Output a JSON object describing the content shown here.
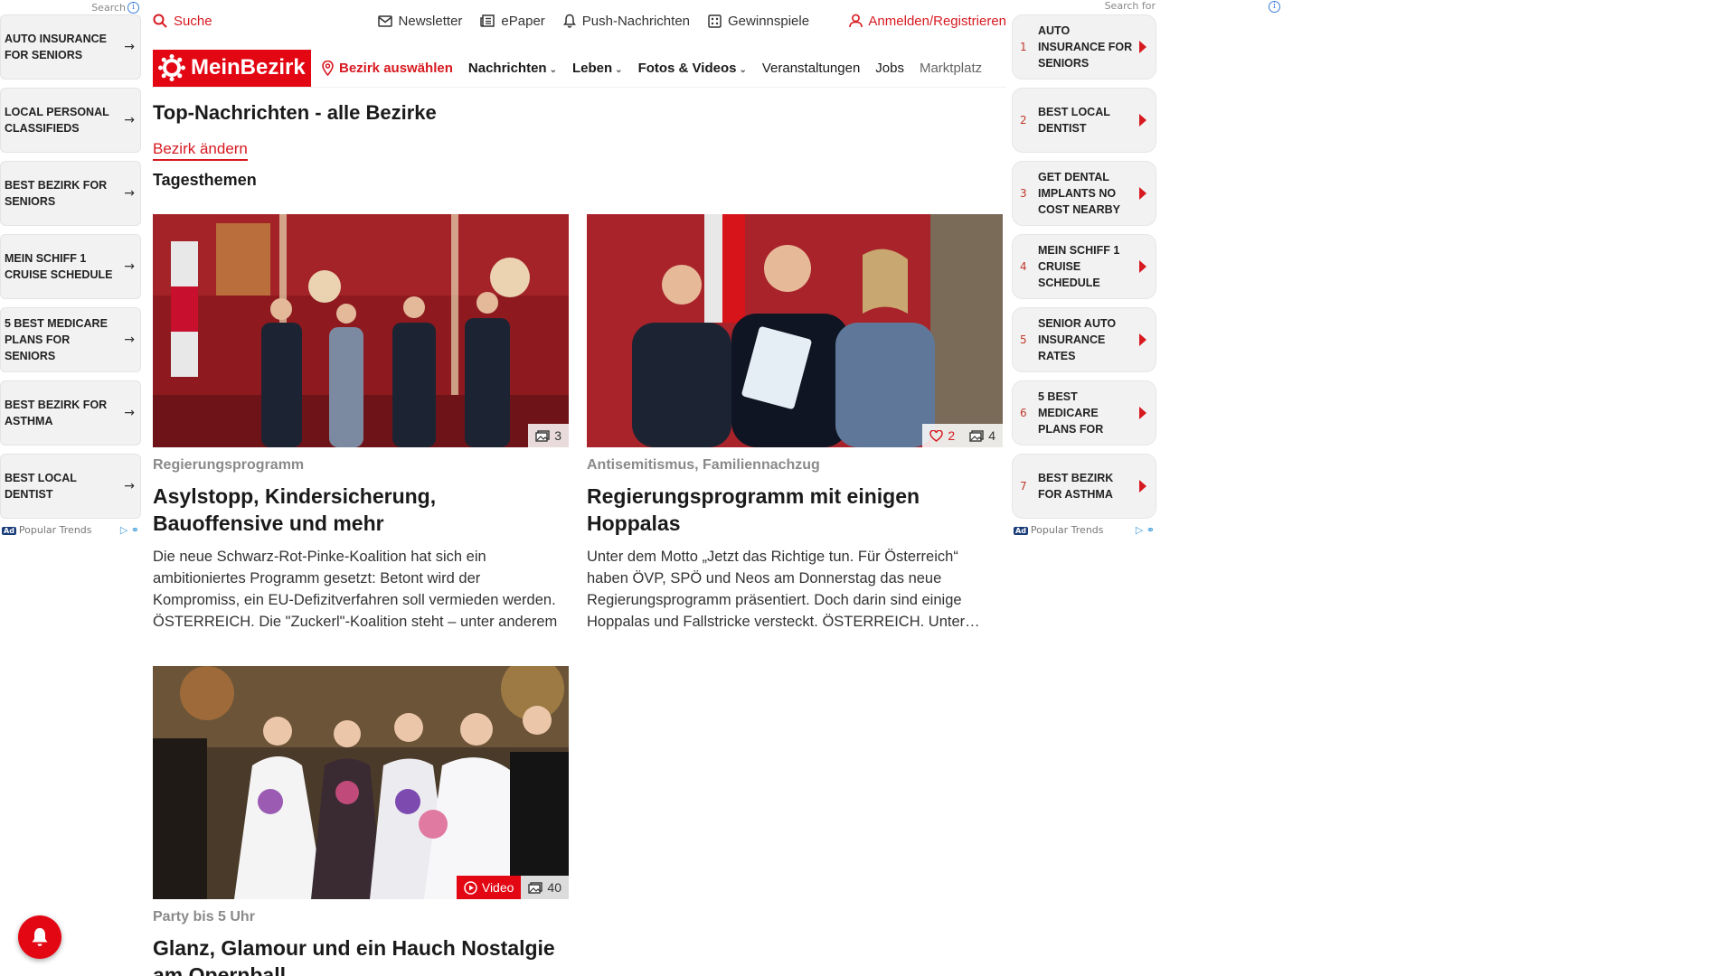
{
  "left_rail": {
    "search_label": "Search",
    "items": [
      {
        "label": "AUTO INSURANCE FOR SENIORS"
      },
      {
        "label": "LOCAL PERSONAL CLASSIFIEDS"
      },
      {
        "label": "BEST BEZIRK FOR SENIORS"
      },
      {
        "label": "MEIN SCHIFF 1 CRUISE SCHEDULE"
      },
      {
        "label": "5 BEST MEDICARE PLANS FOR SENIORS"
      },
      {
        "label": "BEST BEZIRK FOR ASTHMA"
      },
      {
        "label": "BEST LOCAL DENTIST"
      }
    ],
    "footer_badge": "Ad",
    "footer_text": "Popular Trends"
  },
  "utility_bar": {
    "search": "Suche",
    "links": [
      {
        "label": "Newsletter",
        "icon": "mail-icon"
      },
      {
        "label": "ePaper",
        "icon": "newspaper-icon"
      },
      {
        "label": "Push-Nachrichten",
        "icon": "bell-icon"
      },
      {
        "label": "Gewinnspiele",
        "icon": "gift-icon"
      }
    ],
    "login": "Anmelden/Registrieren"
  },
  "main_nav": {
    "logo": "MeinBezirk",
    "bezirk_select": "Bezirk auswählen",
    "items": [
      {
        "label": "Nachrichten",
        "dropdown": true
      },
      {
        "label": "Leben",
        "dropdown": true
      },
      {
        "label": "Fotos & Videos",
        "dropdown": true
      },
      {
        "label": "Veranstaltungen",
        "dropdown": false
      },
      {
        "label": "Jobs",
        "dropdown": false
      },
      {
        "label": "Marktplatz",
        "dropdown": false
      }
    ]
  },
  "content": {
    "page_title": "Top-Nachrichten - alle Bezirke",
    "bezirk_change": "Bezirk ändern",
    "section_title": "Tagesthemen",
    "articles": [
      {
        "kicker": "Regierungsprogramm",
        "headline": "Asylstopp, Kindersicherung, Bauoffensive und mehr",
        "teaser": "Die neue Schwarz-Rot-Pinke-Koalition hat sich ein ambitioniertes Programm gesetzt: Betont wird der Kompromiss, ein EU-Defizitverfahren soll vermieden werden.  ÖSTERREICH. Die \"Zuckerl\"-Koalition steht – unter anderem",
        "photo_count": "3",
        "likes": null,
        "video": null
      },
      {
        "kicker": "Antisemitismus, Familiennachzug",
        "headline": "Regierungsprogramm mit einigen Hoppalas",
        "teaser": "Unter dem Motto „Jetzt das Richtige tun. Für Österreich“ haben ÖVP, SPÖ und Neos am Donnerstag das neue Regierungsprogramm präsentiert. Doch darin sind einige Hoppalas und Fallstricke versteckt. ÖSTERREICH. Unter anderem",
        "photo_count": "4",
        "likes": "2",
        "video": null
      },
      {
        "kicker": "Party bis 5 Uhr",
        "headline": "Glanz, Glamour und ein Hauch Nostalgie am Opernball",
        "teaser": "",
        "photo_count": "40",
        "likes": null,
        "video": "Video"
      }
    ]
  },
  "right_rail": {
    "search_label": "Search for",
    "items": [
      {
        "num": "1",
        "label": "AUTO INSURANCE FOR SENIORS"
      },
      {
        "num": "2",
        "label": "BEST LOCAL DENTIST"
      },
      {
        "num": "3",
        "label": "GET DENTAL IMPLANTS NO COST NEARBY"
      },
      {
        "num": "4",
        "label": "MEIN SCHIFF 1 CRUISE SCHEDULE"
      },
      {
        "num": "5",
        "label": "SENIOR AUTO INSURANCE RATES"
      },
      {
        "num": "6",
        "label": "5 BEST MEDICARE PLANS FOR"
      },
      {
        "num": "7",
        "label": "BEST BEZIRK FOR ASTHMA"
      }
    ],
    "footer_badge": "Ad",
    "footer_text": "Popular Trends"
  },
  "colors": {
    "brand_red": "#e30613",
    "link_red": "#d71920",
    "kicker_gray": "#8a8a8a"
  }
}
